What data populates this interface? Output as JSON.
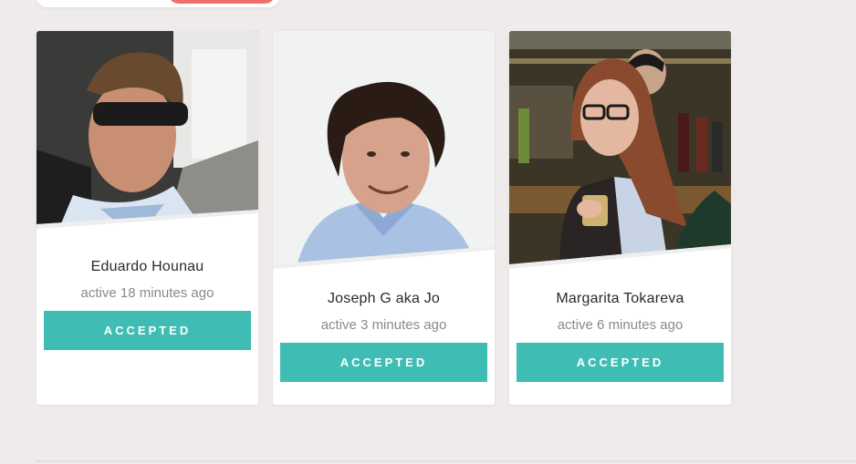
{
  "cards": [
    {
      "name": "Eduardo Hounau",
      "active": "active 18 minutes ago",
      "button": "ACCEPTED"
    },
    {
      "name": "Joseph G aka Jo",
      "active": "active 3 minutes ago",
      "button": "ACCEPTED"
    },
    {
      "name": "Margarita Tokareva",
      "active": "active 6 minutes ago",
      "button": "ACCEPTED"
    }
  ],
  "colors": {
    "accent": "#3fbdb4",
    "pill": "#f26d6d",
    "background": "#efebea"
  }
}
